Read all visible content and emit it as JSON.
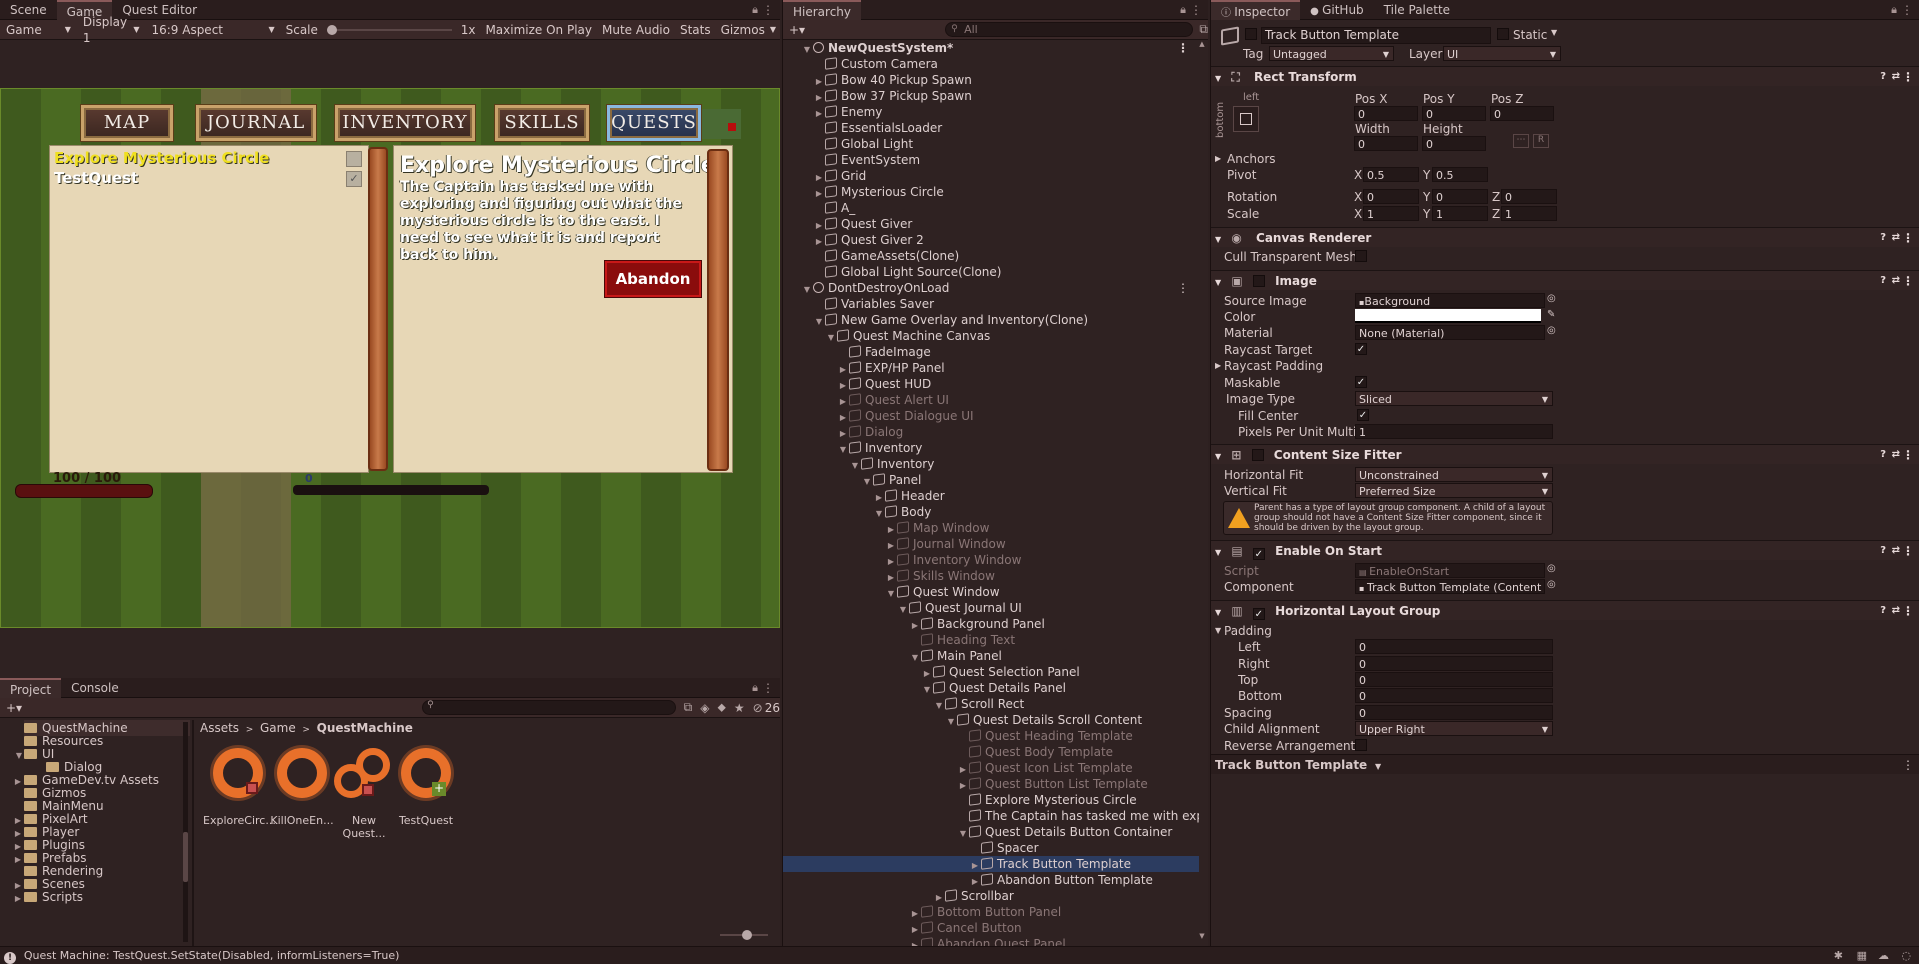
{
  "game_view": {
    "tabs": [
      "Scene",
      "Game",
      "Quest Editor"
    ],
    "toolbar": {
      "mode": "Game",
      "display": "Display 1",
      "aspect": "16:9 Aspect",
      "scale_label": "Scale",
      "scale_value": "1x",
      "buttons": [
        "Maximize On Play",
        "Mute Audio",
        "Stats",
        "Gizmos"
      ]
    },
    "nav_buttons": [
      "MAP",
      "JOURNAL",
      "INVENTORY",
      "SKILLS",
      "QUESTS"
    ],
    "quest_list": {
      "selected_quest": "Explore Mysterious Circle",
      "other_quest": "TestQuest"
    },
    "quest_details": {
      "heading": "Explore Mysterious Circle",
      "body": "The Captain has tasked me with exploring and figuring out what the mysterious circle is to the east. I need to see what it is and report back to him.",
      "abandon_label": "Abandon"
    },
    "hud": {
      "hp_text": "100 / 100",
      "xp_text": "0"
    }
  },
  "hierarchy": {
    "tab": "Hierarchy",
    "search_placeholder": "All",
    "rows": [
      {
        "label": "NewQuestSystem*",
        "depth": 0,
        "exp": "open",
        "icon": "scene",
        "style": "bold"
      },
      {
        "label": "Custom Camera",
        "depth": 1,
        "exp": "",
        "icon": "cube",
        "style": ""
      },
      {
        "label": "Bow 40 Pickup Spawn",
        "depth": 1,
        "exp": "closed",
        "icon": "cube",
        "style": ""
      },
      {
        "label": "Bow 37 Pickup Spawn",
        "depth": 1,
        "exp": "closed",
        "icon": "cube",
        "style": ""
      },
      {
        "label": "Enemy",
        "depth": 1,
        "exp": "closed",
        "icon": "cube",
        "style": ""
      },
      {
        "label": "EssentialsLoader",
        "depth": 1,
        "exp": "",
        "icon": "cube",
        "style": ""
      },
      {
        "label": "Global Light",
        "depth": 1,
        "exp": "",
        "icon": "cube",
        "style": ""
      },
      {
        "label": "EventSystem",
        "depth": 1,
        "exp": "",
        "icon": "cube",
        "style": ""
      },
      {
        "label": "Grid",
        "depth": 1,
        "exp": "closed",
        "icon": "cube",
        "style": ""
      },
      {
        "label": "Mysterious Circle",
        "depth": 1,
        "exp": "closed",
        "icon": "cube",
        "style": ""
      },
      {
        "label": "A_",
        "depth": 1,
        "exp": "",
        "icon": "cube",
        "style": ""
      },
      {
        "label": "Quest Giver",
        "depth": 1,
        "exp": "closed",
        "icon": "cube",
        "style": ""
      },
      {
        "label": "Quest Giver 2",
        "depth": 1,
        "exp": "closed",
        "icon": "cube",
        "style": ""
      },
      {
        "label": "GameAssets(Clone)",
        "depth": 1,
        "exp": "",
        "icon": "cube",
        "style": ""
      },
      {
        "label": "Global Light Source(Clone)",
        "depth": 1,
        "exp": "",
        "icon": "cube",
        "style": ""
      },
      {
        "label": "DontDestroyOnLoad",
        "depth": 0,
        "exp": "open",
        "icon": "scene",
        "style": ""
      },
      {
        "label": "Variables Saver",
        "depth": 1,
        "exp": "",
        "icon": "cube",
        "style": ""
      },
      {
        "label": "New Game Overlay and Inventory(Clone)",
        "depth": 1,
        "exp": "open",
        "icon": "cube",
        "style": ""
      },
      {
        "label": "Quest Machine Canvas",
        "depth": 2,
        "exp": "open",
        "icon": "cube",
        "style": ""
      },
      {
        "label": "FadeImage",
        "depth": 3,
        "exp": "",
        "icon": "cube",
        "style": ""
      },
      {
        "label": "EXP/HP Panel",
        "depth": 3,
        "exp": "closed",
        "icon": "cube",
        "style": ""
      },
      {
        "label": "Quest HUD",
        "depth": 3,
        "exp": "closed",
        "icon": "cube",
        "style": ""
      },
      {
        "label": "Quest Alert UI",
        "depth": 3,
        "exp": "closed",
        "icon": "cube",
        "style": "dim"
      },
      {
        "label": "Quest Dialogue UI",
        "depth": 3,
        "exp": "closed",
        "icon": "cube",
        "style": "dim"
      },
      {
        "label": "Dialog",
        "depth": 3,
        "exp": "closed",
        "icon": "cube",
        "style": "dim"
      },
      {
        "label": "Inventory",
        "depth": 3,
        "exp": "open",
        "icon": "cube",
        "style": ""
      },
      {
        "label": "Inventory",
        "depth": 4,
        "exp": "open",
        "icon": "cube",
        "style": ""
      },
      {
        "label": "Panel",
        "depth": 5,
        "exp": "open",
        "icon": "cube",
        "style": ""
      },
      {
        "label": "Header",
        "depth": 6,
        "exp": "closed",
        "icon": "cube",
        "style": ""
      },
      {
        "label": "Body",
        "depth": 6,
        "exp": "open",
        "icon": "cube",
        "style": ""
      },
      {
        "label": "Map Window",
        "depth": 7,
        "exp": "closed",
        "icon": "cube",
        "style": "dim"
      },
      {
        "label": "Journal Window",
        "depth": 7,
        "exp": "closed",
        "icon": "cube",
        "style": "dim"
      },
      {
        "label": "Inventory Window",
        "depth": 7,
        "exp": "closed",
        "icon": "cube",
        "style": "dim"
      },
      {
        "label": "Skills Window",
        "depth": 7,
        "exp": "closed",
        "icon": "cube",
        "style": "dim"
      },
      {
        "label": "Quest Window",
        "depth": 7,
        "exp": "open",
        "icon": "cube",
        "style": ""
      },
      {
        "label": "Quest Journal UI",
        "depth": 8,
        "exp": "open",
        "icon": "cube",
        "style": ""
      },
      {
        "label": "Background Panel",
        "depth": 9,
        "exp": "closed",
        "icon": "cube",
        "style": ""
      },
      {
        "label": "Heading Text",
        "depth": 9,
        "exp": "",
        "icon": "cube",
        "style": "dim"
      },
      {
        "label": "Main Panel",
        "depth": 9,
        "exp": "open",
        "icon": "cube",
        "style": ""
      },
      {
        "label": "Quest Selection Panel",
        "depth": 10,
        "exp": "closed",
        "icon": "cube",
        "style": ""
      },
      {
        "label": "Quest Details Panel",
        "depth": 10,
        "exp": "open",
        "icon": "cube",
        "style": ""
      },
      {
        "label": "Scroll Rect",
        "depth": 11,
        "exp": "open",
        "icon": "cube",
        "style": ""
      },
      {
        "label": "Quest Details Scroll Content",
        "depth": 12,
        "exp": "open",
        "icon": "cube",
        "style": ""
      },
      {
        "label": "Quest Heading Template",
        "depth": 13,
        "exp": "",
        "icon": "cube",
        "style": "dim"
      },
      {
        "label": "Quest Body Template",
        "depth": 13,
        "exp": "",
        "icon": "cube",
        "style": "dim"
      },
      {
        "label": "Quest Icon List Template",
        "depth": 13,
        "exp": "closed",
        "icon": "cube",
        "style": "dim"
      },
      {
        "label": "Quest Button List Template",
        "depth": 13,
        "exp": "closed",
        "icon": "cube",
        "style": "dim"
      },
      {
        "label": "Explore Mysterious Circle",
        "depth": 13,
        "exp": "",
        "icon": "cube",
        "style": ""
      },
      {
        "label": "The Captain has tasked me with exploring and",
        "depth": 13,
        "exp": "",
        "icon": "cube",
        "style": ""
      },
      {
        "label": "Quest Details Button Container",
        "depth": 13,
        "exp": "open",
        "icon": "cube",
        "style": ""
      },
      {
        "label": "Spacer",
        "depth": 14,
        "exp": "",
        "icon": "cube",
        "style": ""
      },
      {
        "label": "Track Button Template",
        "depth": 14,
        "exp": "closed",
        "icon": "cube",
        "style": "sel"
      },
      {
        "label": "Abandon Button Template",
        "depth": 14,
        "exp": "closed",
        "icon": "cube",
        "style": ""
      },
      {
        "label": "Scrollbar",
        "depth": 11,
        "exp": "closed",
        "icon": "cube",
        "style": ""
      },
      {
        "label": "Bottom Button Panel",
        "depth": 9,
        "exp": "closed",
        "icon": "cube",
        "style": "dim"
      },
      {
        "label": "Cancel Button",
        "depth": 9,
        "exp": "closed",
        "icon": "cube",
        "style": "dim"
      },
      {
        "label": "Abandon Quest Panel",
        "depth": 9,
        "exp": "closed",
        "icon": "cube",
        "style": "dim"
      }
    ]
  },
  "inspector": {
    "tabs": [
      "Inspector",
      "GitHub",
      "Tile Palette"
    ],
    "object_name": "Track Button Template",
    "static_label": "Static",
    "tag_label": "Tag",
    "tag_value": "Untagged",
    "layer_label": "Layer",
    "layer_value": "UI",
    "rect": {
      "title": "Rect Transform",
      "anchor_h": "left",
      "anchor_v": "bottom",
      "posx_label": "Pos X",
      "posy_label": "Pos Y",
      "posz_label": "Pos Z",
      "posx": "0",
      "posy": "0",
      "posz": "0",
      "width_label": "Width",
      "height_label": "Height",
      "width": "0",
      "height": "0",
      "anchors_label": "Anchors",
      "pivot_label": "Pivot",
      "pivot_x": "0.5",
      "pivot_y": "0.5",
      "rotation_label": "Rotation",
      "rot_x": "0",
      "rot_y": "0",
      "rot_z": "0",
      "scale_label": "Scale",
      "scale_x": "1",
      "scale_y": "1",
      "scale_z": "1",
      "x": "X",
      "y": "Y",
      "z": "Z",
      "r_btn": "R"
    },
    "canvas_renderer": {
      "title": "Canvas Renderer",
      "cull_label": "Cull Transparent Mesh"
    },
    "image": {
      "title": "Image",
      "source_label": "Source Image",
      "source_value": "Background",
      "color_label": "Color",
      "material_label": "Material",
      "material_value": "None (Material)",
      "raycast_target_label": "Raycast Target",
      "raycast_padding_label": "Raycast Padding",
      "maskable_label": "Maskable",
      "image_type_label": "Image Type",
      "image_type_value": "Sliced",
      "fill_center_label": "Fill Center",
      "ppu_label": "Pixels Per Unit Multiplier",
      "ppu_value": "1"
    },
    "csf": {
      "title": "Content Size Fitter",
      "hfit_label": "Horizontal Fit",
      "hfit_value": "Unconstrained",
      "vfit_label": "Vertical Fit",
      "vfit_value": "Preferred Size",
      "warning": "Parent has a type of layout group component. A child of a layout group should not have a Content Size Fitter component, since it should be driven by the layout group."
    },
    "eos": {
      "title": "Enable On Start",
      "script_label": "Script",
      "script_value": "EnableOnStart",
      "component_label": "Component",
      "component_value": "Track Button Template (Content Size"
    },
    "hlg": {
      "title": "Horizontal Layout Group",
      "padding_label": "Padding",
      "left_label": "Left",
      "left": "0",
      "right_label": "Right",
      "right": "0",
      "top_label": "Top",
      "top": "0",
      "bottom_label": "Bottom",
      "bottom": "0",
      "spacing_label": "Spacing",
      "spacing": "0",
      "align_label": "Child Alignment",
      "align_value": "Upper Right",
      "reverse_label": "Reverse Arrangement"
    },
    "footer": "Track Button Template"
  },
  "project": {
    "tabs": [
      "Project",
      "Console"
    ],
    "count": "26",
    "folders": [
      {
        "label": "QuestMachine",
        "depth": 1,
        "exp": ""
      },
      {
        "label": "Resources",
        "depth": 1,
        "exp": ""
      },
      {
        "label": "UI",
        "depth": 1,
        "exp": "open"
      },
      {
        "label": "Dialog",
        "depth": 2,
        "exp": ""
      },
      {
        "label": "GameDev.tv Assets",
        "depth": 0,
        "exp": "closed"
      },
      {
        "label": "Gizmos",
        "depth": 0,
        "exp": ""
      },
      {
        "label": "MainMenu",
        "depth": 0,
        "exp": ""
      },
      {
        "label": "PixelArt",
        "depth": 0,
        "exp": "closed"
      },
      {
        "label": "Player",
        "depth": 0,
        "exp": "closed"
      },
      {
        "label": "Plugins",
        "depth": 0,
        "exp": "closed"
      },
      {
        "label": "Prefabs",
        "depth": 0,
        "exp": "closed"
      },
      {
        "label": "Rendering",
        "depth": 0,
        "exp": ""
      },
      {
        "label": "Scenes",
        "depth": 0,
        "exp": "closed"
      },
      {
        "label": "Scripts",
        "depth": 0,
        "exp": "closed"
      }
    ],
    "breadcrumb": [
      "Assets",
      "Game",
      "QuestMachine"
    ],
    "assets": [
      "ExploreCirc...",
      "KillOneEn...",
      "New Quest...",
      "TestQuest"
    ]
  },
  "status_bar": "Quest Machine: TestQuest.SetState(Disabled, informListeners=True)"
}
